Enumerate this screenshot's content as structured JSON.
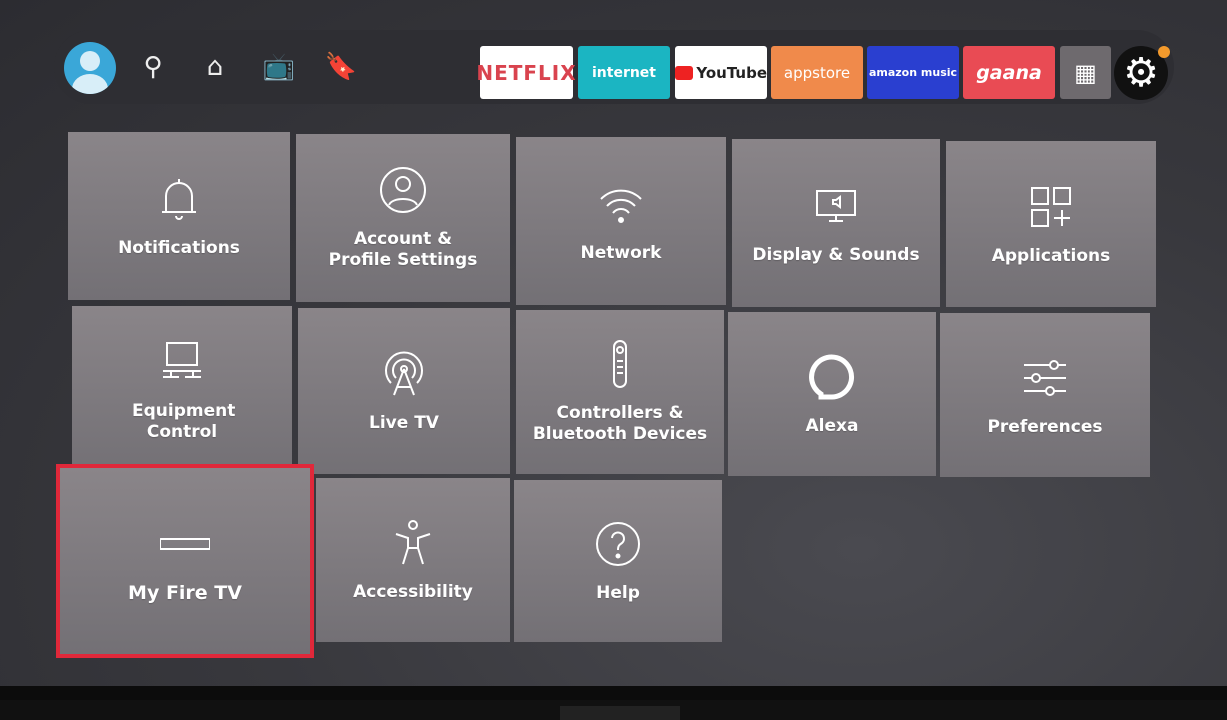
{
  "nav": {
    "icons": [
      "profile-avatar",
      "search-icon",
      "home-icon",
      "live-tv-icon",
      "bookmark-icon"
    ]
  },
  "apps": [
    {
      "label": "NETFLIX",
      "bg": "#ffffff",
      "fg": "#d9434e"
    },
    {
      "label": "internet",
      "bg": "#1bb5c2",
      "fg": "#ffffff"
    },
    {
      "label": "YouTube",
      "bg": "#ffffff",
      "fg": "#222222"
    },
    {
      "label": "appstore",
      "bg": "#f08a4b",
      "fg": "#ffffff"
    },
    {
      "label": "amazon music",
      "bg": "#2a3fd0",
      "fg": "#ffffff"
    },
    {
      "label": "gaana",
      "bg": "#e94b54",
      "fg": "#ffffff"
    }
  ],
  "settings_tiles": [
    {
      "label": "Notifications",
      "icon": "bell-icon"
    },
    {
      "label": "Account & Profile Settings",
      "icon": "user-icon"
    },
    {
      "label": "Network",
      "icon": "wifi-icon"
    },
    {
      "label": "Display & Sounds",
      "icon": "display-icon"
    },
    {
      "label": "Applications",
      "icon": "apps-icon"
    },
    {
      "label": "Equipment Control",
      "icon": "equipment-icon"
    },
    {
      "label": "Live TV",
      "icon": "antenna-icon"
    },
    {
      "label": "Controllers & Bluetooth Devices",
      "icon": "remote-icon"
    },
    {
      "label": "Alexa",
      "icon": "alexa-icon"
    },
    {
      "label": "Preferences",
      "icon": "sliders-icon"
    },
    {
      "label": "My Fire TV",
      "icon": "fire-tv-device-icon",
      "highlighted": true
    },
    {
      "label": "Accessibility",
      "icon": "accessibility-icon"
    },
    {
      "label": "Help",
      "icon": "help-icon"
    }
  ],
  "colors": {
    "highlight": "#e0283a",
    "settings_badge": "#f39a2c"
  }
}
